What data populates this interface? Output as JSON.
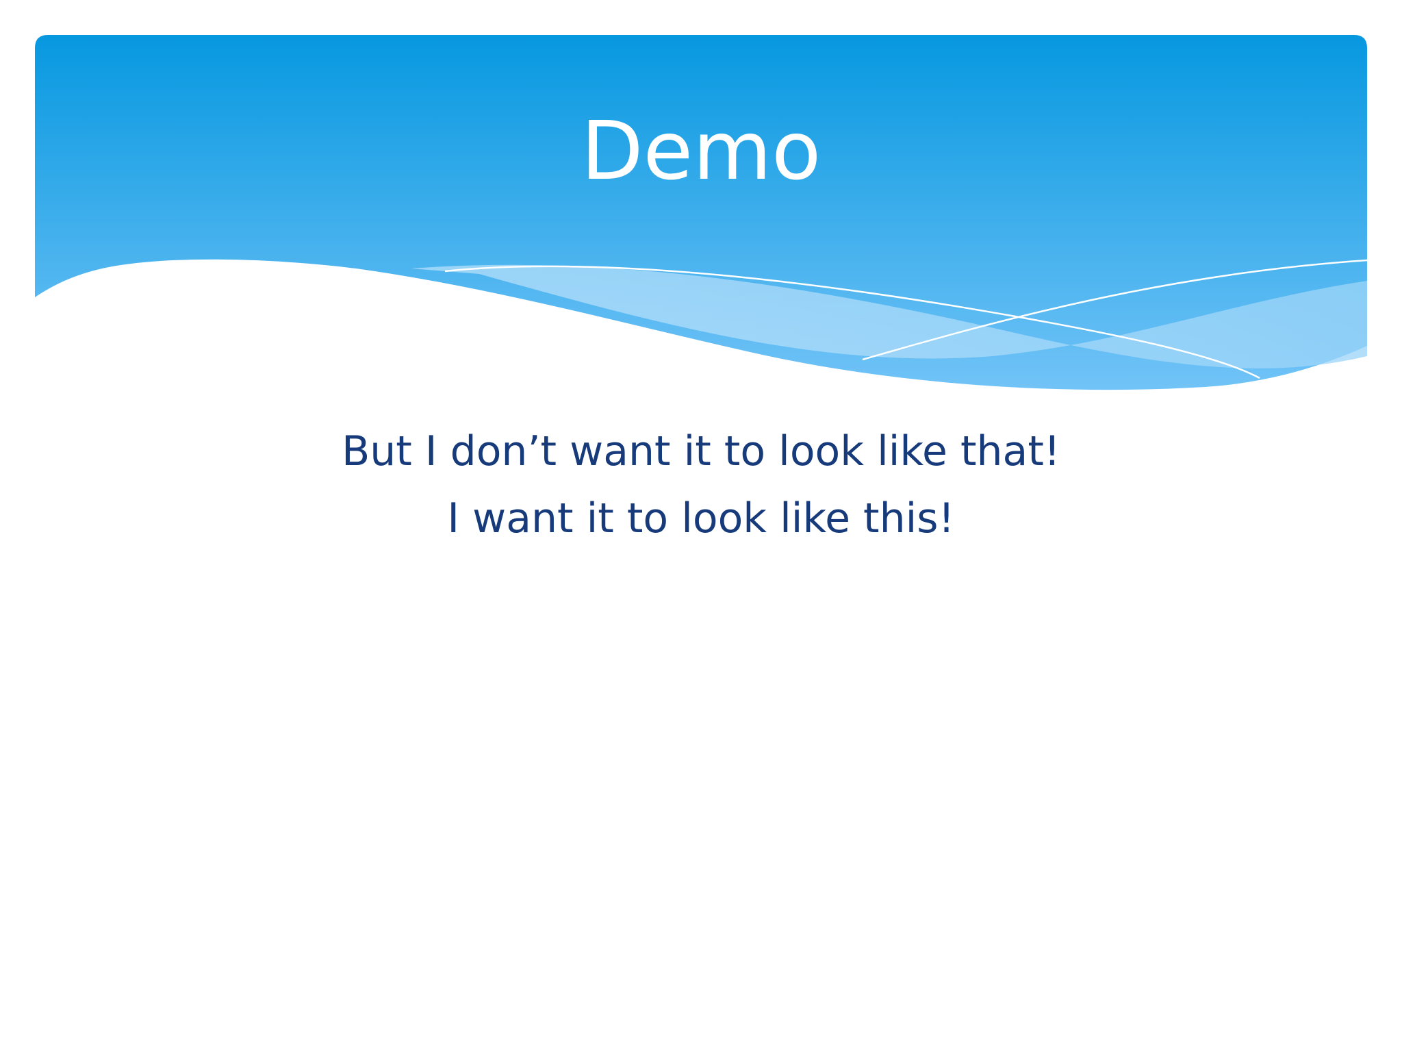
{
  "slide": {
    "title": "Demo",
    "body_lines": [
      "But I don’t want it to look like that!",
      "I want it to look like this!"
    ]
  },
  "colors": {
    "header_top": "#0798e0",
    "header_bottom": "#71c3f7",
    "text_body": "#173a7a",
    "text_title": "#ffffff"
  }
}
